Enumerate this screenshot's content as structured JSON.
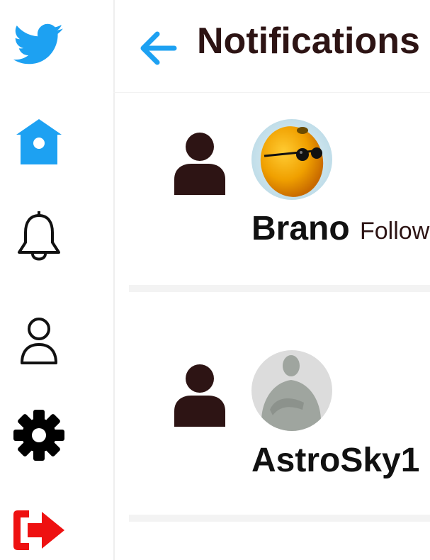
{
  "header": {
    "title": "Notifications",
    "back_icon": "arrow-left-icon"
  },
  "sidebar": {
    "items": [
      {
        "name": "twitter-logo",
        "icon": "bird-icon",
        "color": "#1da1f2"
      },
      {
        "name": "home",
        "icon": "home-icon",
        "color": "#1da1f2"
      },
      {
        "name": "notifications",
        "icon": "bell-icon",
        "color": "#111111"
      },
      {
        "name": "profile",
        "icon": "user-icon",
        "color": "#111111"
      },
      {
        "name": "settings",
        "icon": "gear-icon",
        "color": "#111111"
      },
      {
        "name": "logout",
        "icon": "logout-icon",
        "color": "#ee1111"
      }
    ]
  },
  "notifications": [
    {
      "user": "Brano",
      "action": "Follow",
      "type_icon": "user-icon",
      "avatar": "lemon-with-sunglasses"
    },
    {
      "user": "AstroSky1",
      "action": "",
      "type_icon": "user-icon",
      "avatar": "default-silhouette"
    }
  ],
  "colors": {
    "accent": "#1da1f2",
    "title": "#2d1414",
    "logout": "#ee1111",
    "separator": "#f3f3f3"
  }
}
